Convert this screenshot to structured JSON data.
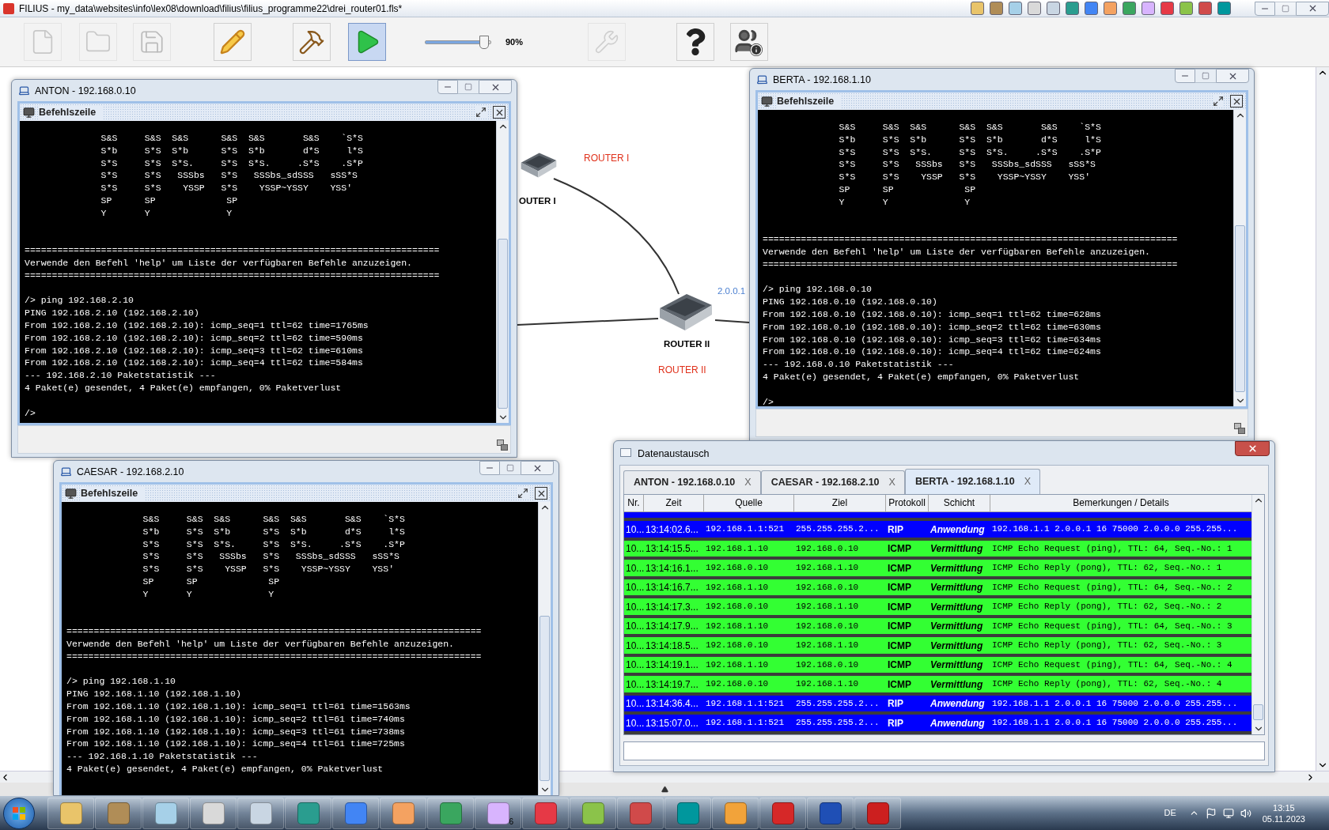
{
  "app_title": "FILIUS - my_data\\websites\\info\\lex08\\download\\filius\\filius_programme22\\drei_router01.fls*",
  "toolbar": {
    "buttons": [
      {
        "kind": "new",
        "disabled": true,
        "selected": false
      },
      {
        "kind": "open",
        "disabled": true,
        "selected": false
      },
      {
        "kind": "save",
        "disabled": true,
        "selected": false
      },
      {
        "kind": "design",
        "disabled": false,
        "selected": false
      },
      {
        "kind": "build",
        "disabled": false,
        "selected": false
      },
      {
        "kind": "run",
        "disabled": false,
        "selected": true
      }
    ],
    "speed": {
      "level": 0.9,
      "reading": "90%"
    },
    "buttons_right": [
      {
        "kind": "tool",
        "disabled": true
      },
      {
        "kind": "help",
        "disabled": false
      },
      {
        "kind": "info",
        "disabled": false
      }
    ]
  },
  "canvas": {
    "nodes": [
      {
        "label": "OUTER I",
        "note": "ROUTER I"
      },
      {
        "label": "ROUTER II",
        "note": "ROUTER II",
        "address": "2.0.0.1"
      }
    ]
  },
  "terminals": [
    {
      "title": "ANTON - 192.168.0.10",
      "panel_title": "Befehlszeile",
      "banner": [
        "              S&S     S&S  S&S      S&S  S&S       S&S    `S*S",
        "              S*b     S*S  S*b      S*S  S*b       d*S     l*S",
        "              S*S     S*S  S*S.     S*S  S*S.     .S*S    .S*P",
        "              S*S     S*S   SSSbs   S*S   SSSbs_sdSSS   sSS*S",
        "              S*S     S*S    YSSP   S*S    YSSP~YSSY    YSS'",
        "              SP      SP             SP",
        "              Y       Y              Y"
      ],
      "notice": [
        "============================================================================",
        "Verwende den Befehl 'help' um Liste der verfügbaren Befehle anzuzeigen.",
        "============================================================================"
      ],
      "session": [
        "/> ping 192.168.2.10",
        "PING 192.168.2.10 (192.168.2.10)",
        "From 192.168.2.10 (192.168.2.10): icmp_seq=1 ttl=62 time=1765ms",
        "From 192.168.2.10 (192.168.2.10): icmp_seq=2 ttl=62 time=590ms",
        "From 192.168.2.10 (192.168.2.10): icmp_seq=3 ttl=62 time=610ms",
        "From 192.168.2.10 (192.168.2.10): icmp_seq=4 ttl=62 time=584ms",
        "--- 192.168.2.10 Paketstatistik ---",
        "4 Paket(e) gesendet, 4 Paket(e) empfangen, 0% Paketverlust"
      ],
      "prompt": "/>"
    },
    {
      "title": "BERTA - 192.168.1.10",
      "panel_title": "Befehlszeile",
      "banner": [
        "              S&S     S&S  S&S      S&S  S&S       S&S    `S*S",
        "              S*b     S*S  S*b      S*S  S*b       d*S     l*S",
        "              S*S     S*S  S*S.     S*S  S*S.     .S*S    .S*P",
        "              S*S     S*S   SSSbs   S*S   SSSbs_sdSSS   sSS*S",
        "              S*S     S*S    YSSP   S*S    YSSP~YSSY    YSS'",
        "              SP      SP             SP",
        "              Y       Y              Y"
      ],
      "notice": [
        "============================================================================",
        "Verwende den Befehl 'help' um Liste der verfügbaren Befehle anzuzeigen.",
        "============================================================================"
      ],
      "session": [
        "/> ping 192.168.0.10",
        "PING 192.168.0.10 (192.168.0.10)",
        "From 192.168.0.10 (192.168.0.10): icmp_seq=1 ttl=62 time=628ms",
        "From 192.168.0.10 (192.168.0.10): icmp_seq=2 ttl=62 time=630ms",
        "From 192.168.0.10 (192.168.0.10): icmp_seq=3 ttl=62 time=634ms",
        "From 192.168.0.10 (192.168.0.10): icmp_seq=4 ttl=62 time=624ms",
        "--- 192.168.0.10 Paketstatistik ---",
        "4 Paket(e) gesendet, 4 Paket(e) empfangen, 0% Paketverlust"
      ],
      "prompt": "/>"
    },
    {
      "title": "CAESAR - 192.168.2.10",
      "panel_title": "Befehlszeile",
      "banner": [
        "              S&S     S&S  S&S      S&S  S&S       S&S    `S*S",
        "              S*b     S*S  S*b      S*S  S*b       d*S     l*S",
        "              S*S     S*S  S*S.     S*S  S*S.     .S*S    .S*P",
        "              S*S     S*S   SSSbs   S*S   SSSbs_sdSSS   sSS*S",
        "              S*S     S*S    YSSP   S*S    YSSP~YSSY    YSS'",
        "              SP      SP             SP",
        "              Y       Y              Y"
      ],
      "notice": [
        "============================================================================",
        "Verwende den Befehl 'help' um Liste der verfügbaren Befehle anzuzeigen.",
        "============================================================================"
      ],
      "session": [
        "/> ping 192.168.1.10",
        "PING 192.168.1.10 (192.168.1.10)",
        "From 192.168.1.10 (192.168.1.10): icmp_seq=1 ttl=61 time=1563ms",
        "From 192.168.1.10 (192.168.1.10): icmp_seq=2 ttl=61 time=740ms",
        "From 192.168.1.10 (192.168.1.10): icmp_seq=3 ttl=61 time=738ms",
        "From 192.168.1.10 (192.168.1.10): icmp_seq=4 ttl=61 time=725ms",
        "--- 192.168.1.10 Paketstatistik ---",
        "4 Paket(e) gesendet, 4 Paket(e) empfangen, 0% Paketverlust"
      ]
    }
  ],
  "exchange": {
    "title": "Datenaustausch",
    "tabs": [
      {
        "label": "ANTON - 192.168.0.10",
        "close": "X",
        "selected": false
      },
      {
        "label": "CAESAR - 192.168.2.10",
        "close": "X",
        "selected": false
      },
      {
        "label": "BERTA - 192.168.1.10",
        "close": "X",
        "selected": true
      }
    ],
    "columns": [
      "Nr.",
      "Zeit",
      "Quelle",
      "Ziel",
      "Protokoll",
      "Schicht",
      "Bemerkungen / Details"
    ],
    "rows": [
      {
        "kind": "rip",
        "cells": [
          "10...",
          "13:14:02.6...",
          "192.168.1.1:521",
          "255.255.255.2...",
          "RIP",
          "Anwendung",
          "192.168.1.1 2.0.0.1 16 75000 2.0.0.0 255.255..."
        ]
      },
      {
        "kind": "icmp",
        "cells": [
          "10...",
          "13:14:15.5...",
          "192.168.1.10",
          "192.168.0.10",
          "ICMP",
          "Vermittlung",
          "ICMP Echo Request (ping), TTL: 64, Seq.-No.: 1"
        ]
      },
      {
        "kind": "icmp",
        "cells": [
          "10...",
          "13:14:16.1...",
          "192.168.0.10",
          "192.168.1.10",
          "ICMP",
          "Vermittlung",
          "ICMP Echo Reply (pong), TTL: 62, Seq.-No.: 1"
        ]
      },
      {
        "kind": "icmp",
        "cells": [
          "10...",
          "13:14:16.7...",
          "192.168.1.10",
          "192.168.0.10",
          "ICMP",
          "Vermittlung",
          "ICMP Echo Request (ping), TTL: 64, Seq.-No.: 2"
        ]
      },
      {
        "kind": "icmp",
        "cells": [
          "10...",
          "13:14:17.3...",
          "192.168.0.10",
          "192.168.1.10",
          "ICMP",
          "Vermittlung",
          "ICMP Echo Reply (pong), TTL: 62, Seq.-No.: 2"
        ]
      },
      {
        "kind": "icmp",
        "cells": [
          "10...",
          "13:14:17.9...",
          "192.168.1.10",
          "192.168.0.10",
          "ICMP",
          "Vermittlung",
          "ICMP Echo Request (ping), TTL: 64, Seq.-No.: 3"
        ]
      },
      {
        "kind": "icmp",
        "cells": [
          "10...",
          "13:14:18.5...",
          "192.168.0.10",
          "192.168.1.10",
          "ICMP",
          "Vermittlung",
          "ICMP Echo Reply (pong), TTL: 62, Seq.-No.: 3"
        ]
      },
      {
        "kind": "icmp",
        "cells": [
          "10...",
          "13:14:19.1...",
          "192.168.1.10",
          "192.168.0.10",
          "ICMP",
          "Vermittlung",
          "ICMP Echo Request (ping), TTL: 64, Seq.-No.: 4"
        ]
      },
      {
        "kind": "icmp",
        "cells": [
          "10...",
          "13:14:19.7...",
          "192.168.0.10",
          "192.168.1.10",
          "ICMP",
          "Vermittlung",
          "ICMP Echo Reply (pong), TTL: 62, Seq.-No.: 4"
        ]
      },
      {
        "kind": "rip",
        "cells": [
          "10...",
          "13:14:36.4...",
          "192.168.1.1:521",
          "255.255.255.2...",
          "RIP",
          "Anwendung",
          "192.168.1.1 2.0.0.1 16 75000 2.0.0.0 255.255..."
        ]
      },
      {
        "kind": "rip",
        "cells": [
          "10...",
          "13:15:07.0...",
          "192.168.1.1:521",
          "255.255.255.2...",
          "RIP",
          "Anwendung",
          "192.168.1.1 2.0.0.1 16 75000 2.0.0.0 255.255..."
        ]
      }
    ]
  },
  "taskbar": {
    "badge": "6",
    "language": "DE",
    "time": "13:15",
    "date": "05.11.2023"
  }
}
